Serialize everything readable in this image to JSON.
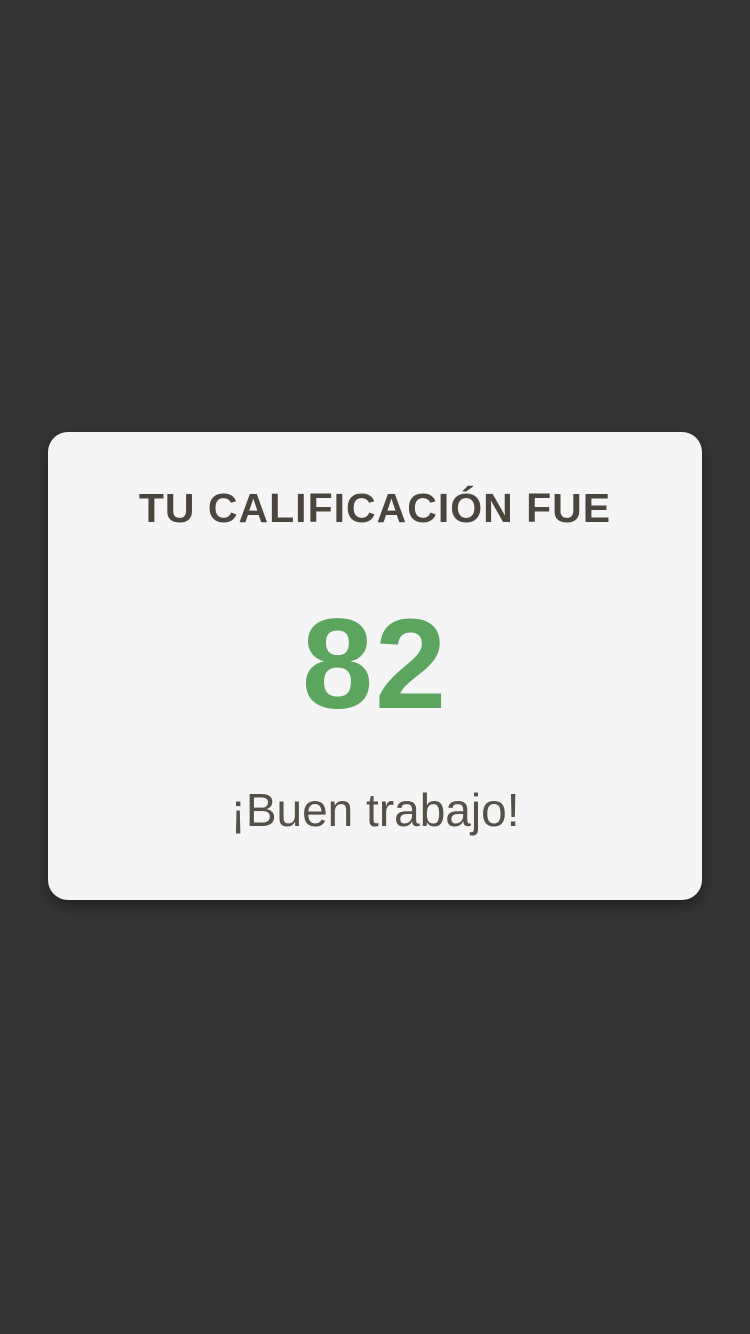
{
  "result_card": {
    "heading": "TU CALIFICACIÓN FUE",
    "score": "82",
    "message": "¡Buen trabajo!"
  },
  "colors": {
    "background": "#343434",
    "card": "#f5f5f5",
    "heading": "#4a463d",
    "score": "#5ca55f",
    "message": "#555149"
  }
}
